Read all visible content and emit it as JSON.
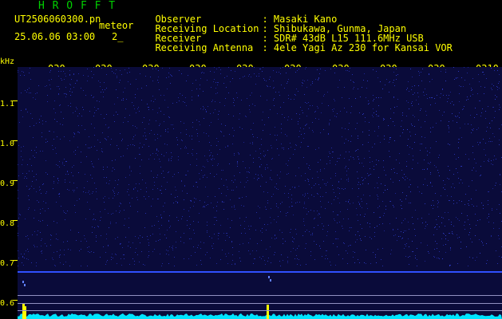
{
  "header": {
    "brand": "H R O F F T",
    "filename": "UT2506060300.pn",
    "mode": "meteor",
    "datetime": "25.06.06 03:00",
    "channel": "2_"
  },
  "info": [
    {
      "label": "Observer",
      "value": ": Masaki Kano"
    },
    {
      "label": "Receiving Location",
      "value": ": Shibukawa, Gunma, Japan"
    },
    {
      "label": "Receiver",
      "value": ": SDR# 43dB L15 111.6MHz USB"
    },
    {
      "label": "Receiving Antenna",
      "value": ": 4ele Yagi Az 230 for Kansai VOR"
    }
  ],
  "axis": {
    "y_unit": "kHz",
    "y_ticks": [
      "1.1",
      "1.0",
      "0.9",
      "0.8",
      "0.7",
      "0.6"
    ],
    "x_ticks": [
      "030",
      "030",
      "030",
      "030",
      "030",
      "030",
      "030",
      "030",
      "030",
      "0310"
    ]
  },
  "colors": {
    "label": "#ffff00",
    "brand": "#00d000",
    "background": "#0a0b3a",
    "signal_line": "#3050ff",
    "spectrum": "#00e5ff",
    "peak": "#ffff00"
  }
}
